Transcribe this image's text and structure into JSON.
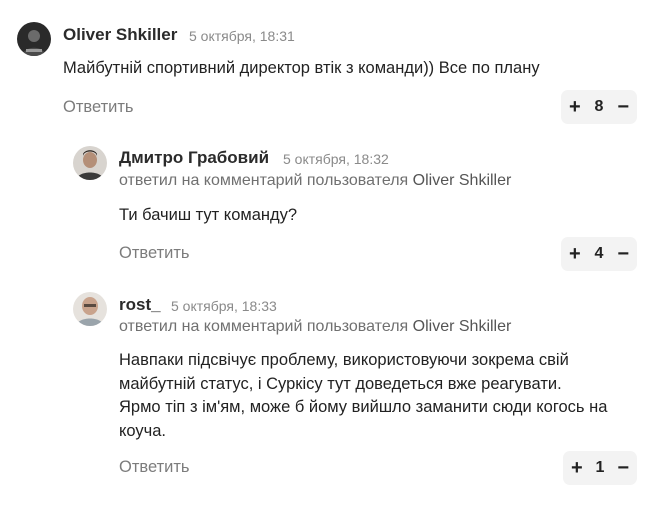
{
  "comments": [
    {
      "author": "Oliver Shkiller",
      "time": "5 октября, 18:31",
      "reply_to": null,
      "text": [
        "Майбутній спортивний директор втік з команди)) Все по плану"
      ],
      "reply_label": "Ответить",
      "votes": "8",
      "avatar": "dark-portrait"
    },
    {
      "author": "Дмитро Грабовий",
      "time": "5 октября, 18:32",
      "reply_to_prefix": "ответил на комментарий пользователя",
      "reply_to_user": "Oliver Shkiller",
      "text": [
        "Ти бачиш тут команду?"
      ],
      "reply_label": "Ответить",
      "votes": "4",
      "avatar": "man-portrait"
    },
    {
      "author": "rost_",
      "time": "5 октября, 18:33",
      "reply_to_prefix": "ответил на комментарий пользователя",
      "reply_to_user": "Oliver Shkiller",
      "text": [
        "Навпаки підсвічує проблему, використовуючи зокрема свій",
        "майбутній статус, і Суркісу тут доведеться вже реагувати.",
        "Ярмо тіп з ім'ям, може б йому вийшло заманити сюди когось на",
        "коуча."
      ],
      "reply_label": "Ответить",
      "votes": "1",
      "avatar": "bald-man-portrait"
    }
  ],
  "icons": {
    "plus": "+",
    "minus": "−"
  }
}
